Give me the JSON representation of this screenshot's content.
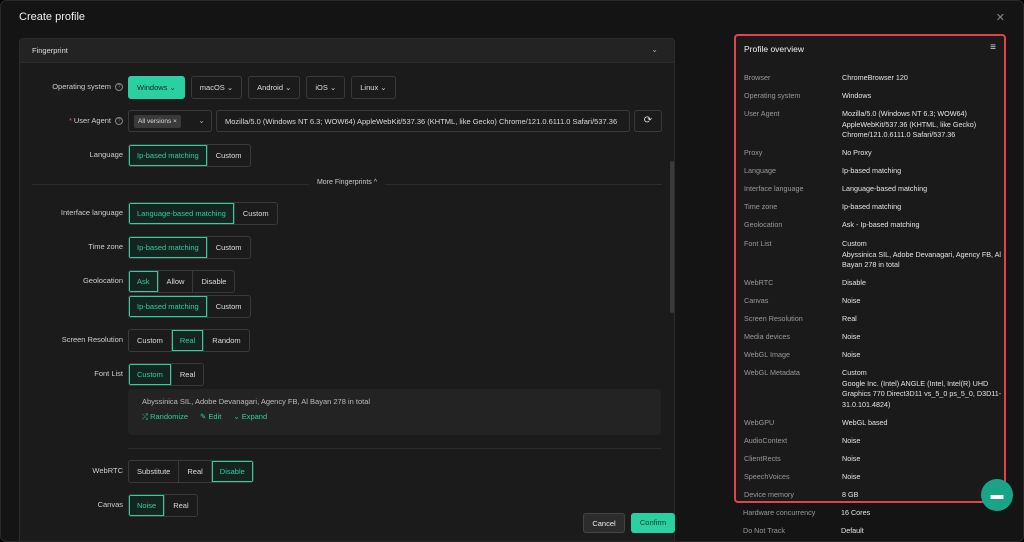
{
  "modal": {
    "title": "Create profile",
    "close": "✕"
  },
  "section": {
    "title": "Fingerprint",
    "chev": "⌄"
  },
  "os": {
    "label": "Operating system",
    "help": "?",
    "items": [
      {
        "label": "Windows ⌄"
      },
      {
        "label": "macOS ⌄"
      },
      {
        "label": "Android ⌄"
      },
      {
        "label": "iOS ⌄"
      },
      {
        "label": "Linux ⌄"
      }
    ]
  },
  "ua": {
    "req": "*",
    "label": "User Agent",
    "help": "?",
    "tag": "All versions  ×",
    "dd": "⌄",
    "value": "Mozilla/5.0 (Windows NT 6.3; WOW64) AppleWebKit/537.36 (KHTML, like Gecko) Chrome/121.0.6111.0 Safari/537.36",
    "refresh": "⟳"
  },
  "language": {
    "label": "Language",
    "options": [
      "Ip-based matching",
      "Custom"
    ]
  },
  "more": {
    "label": "More Fingerprints ^"
  },
  "interface_language": {
    "label": "Interface language",
    "options": [
      "Language-based matching",
      "Custom"
    ]
  },
  "timezone": {
    "label": "Time zone",
    "options": [
      "Ip-based matching",
      "Custom"
    ]
  },
  "geolocation": {
    "label": "Geolocation",
    "options": [
      "Ask",
      "Allow",
      "Disable"
    ],
    "sub_options": [
      "Ip-based matching",
      "Custom"
    ]
  },
  "resolution": {
    "label": "Screen Resolution",
    "options": [
      "Custom",
      "Real",
      "Random"
    ]
  },
  "fontlist": {
    "label": "Font List",
    "options": [
      "Custom",
      "Real"
    ],
    "text": "Abyssinica SIL, Adobe Devanagari, Agency FB, Al Bayan 278 in total",
    "randomize": "⤮ Randomize",
    "edit": "✎ Edit",
    "expand": "⌄ Expand"
  },
  "webrtc": {
    "label": "WebRTC",
    "options": [
      "Substitute",
      "Real",
      "Disable"
    ]
  },
  "canvas": {
    "label": "Canvas",
    "options": [
      "Noise",
      "Real"
    ]
  },
  "footer": {
    "cancel": "Cancel",
    "confirm": "Confirm"
  },
  "overview": {
    "title": "Profile overview",
    "icon": "≡",
    "rows": [
      {
        "k": "Browser",
        "v": "ChromeBrowser 120"
      },
      {
        "k": "Operating system",
        "v": "Windows"
      },
      {
        "k": "User Agent",
        "v": "Mozilla/5.0 (Windows NT 6.3; WOW64) AppleWebKit/537.36 (KHTML, like Gecko) Chrome/121.0.6111.0 Safari/537.36"
      },
      {
        "k": "Proxy",
        "v": "No Proxy"
      },
      {
        "k": "Language",
        "v": "Ip-based matching"
      },
      {
        "k": "Interface language",
        "v": "Language-based matching"
      },
      {
        "k": "Time zone",
        "v": "Ip-based matching"
      },
      {
        "k": "Geolocation",
        "v": "Ask - Ip-based matching"
      },
      {
        "k": "Font List",
        "v": "Custom\nAbyssinica SIL, Adobe Devanagari, Agency FB, Al Bayan 278 in total"
      },
      {
        "k": "WebRTC",
        "v": "Disable"
      },
      {
        "k": "Canvas",
        "v": "Noise"
      },
      {
        "k": "Screen Resolution",
        "v": "Real"
      },
      {
        "k": "Media devices",
        "v": "Noise"
      },
      {
        "k": "WebGL Image",
        "v": "Noise"
      },
      {
        "k": "WebGL Metadata",
        "v": "Custom\nGoogle Inc. (Intel) ANGLE (Intel, Intel(R) UHD Graphics 770 Direct3D11 vs_5_0 ps_5_0, D3D11-31.0.101.4824)"
      },
      {
        "k": "WebGPU",
        "v": "WebGL based"
      },
      {
        "k": "AudioContext",
        "v": "Noise"
      },
      {
        "k": "ClientRects",
        "v": "Noise"
      },
      {
        "k": "SpeechVoices",
        "v": "Noise"
      },
      {
        "k": "Device memory",
        "v": "8 GB"
      }
    ],
    "outside": [
      {
        "k": "Hardware concurrency",
        "v": "16 Cores"
      },
      {
        "k": "Do Not Track",
        "v": "Default"
      }
    ]
  },
  "chat": {
    "icon": "▬"
  }
}
